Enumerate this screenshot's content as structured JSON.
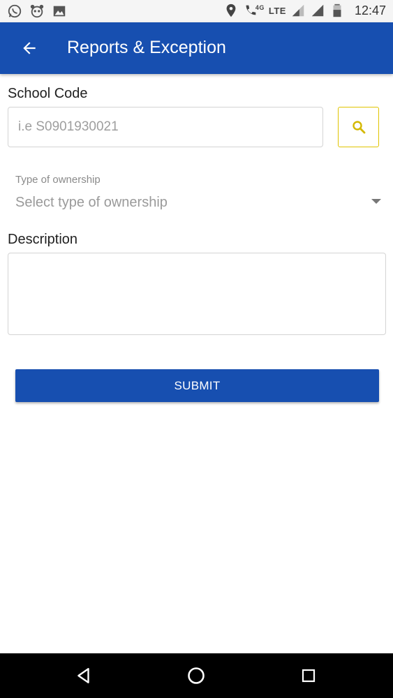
{
  "status_bar": {
    "time": "12:47",
    "network": "LTE",
    "network_small": "4G",
    "left_icons": [
      "whatsapp-icon",
      "panda-icon",
      "image-icon"
    ],
    "right_icons": [
      "location-icon",
      "phone-signal-icon",
      "signal-icon",
      "signal-icon",
      "battery-icon"
    ]
  },
  "app_bar": {
    "title": "Reports & Exception",
    "back_icon": "arrow-left-icon",
    "color": "#174fb0"
  },
  "form": {
    "school_code": {
      "label": "School Code",
      "placeholder": "i.e S0901930021",
      "value": "",
      "search_icon": "search-icon",
      "search_border_color": "#e0c400"
    },
    "ownership": {
      "label": "Type of ownership",
      "placeholder": "Select type of ownership",
      "icon": "caret-down-icon"
    },
    "description": {
      "label": "Description",
      "value": ""
    },
    "submit_label": "SUBMIT"
  },
  "nav_bar": {
    "back": "triangle-back-icon",
    "home": "circle-home-icon",
    "recents": "square-recents-icon"
  }
}
